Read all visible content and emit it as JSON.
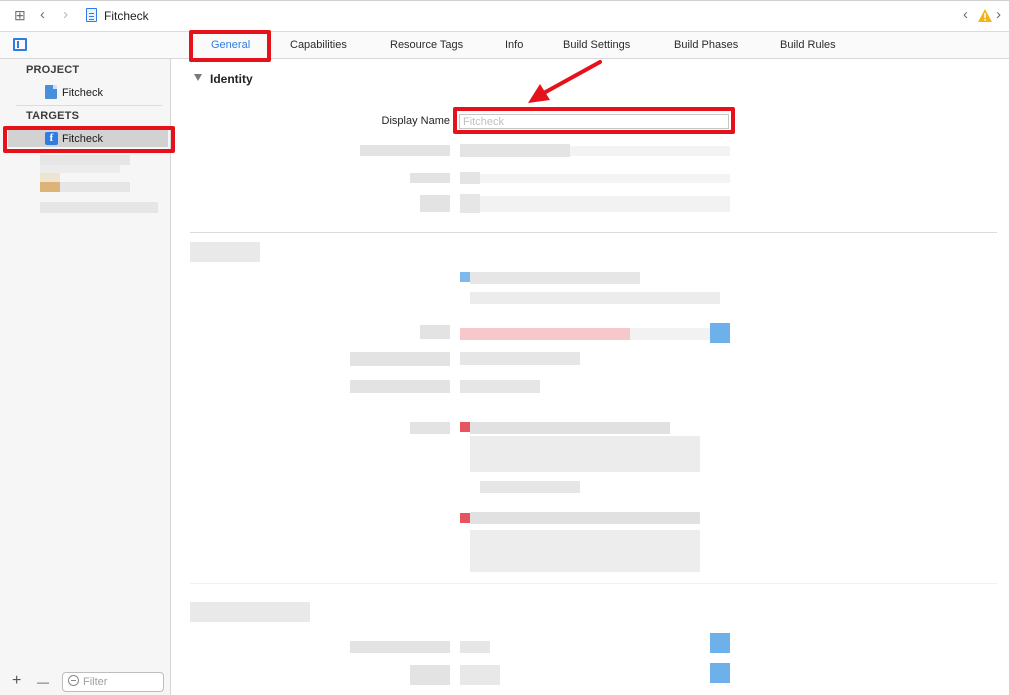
{
  "toolbar": {
    "grid_icon": "grid-icon",
    "back_icon": "chevron-left-icon",
    "forward_icon": "chevron-right-icon",
    "file_icon": "project-file-icon",
    "breadcrumb_label": "Fitcheck",
    "warning_icon": "warning-icon"
  },
  "tabs": [
    "General",
    "Capabilities",
    "Resource Tags",
    "Info",
    "Build Settings",
    "Build Phases",
    "Build Rules"
  ],
  "active_tab": "General",
  "sidebar": {
    "project_header": "PROJECT",
    "project_item": "Fitcheck",
    "targets_header": "TARGETS",
    "target_item": "Fitcheck",
    "target_icon_glyph": "f",
    "filter_placeholder": "Filter",
    "add_glyph": "+",
    "remove_glyph": "—"
  },
  "editor": {
    "section_title": "Identity",
    "display_name_label": "Display Name",
    "display_name_placeholder": "Fitcheck"
  },
  "annotation_color": "#e5121b",
  "accent_color": "#2f7de1"
}
